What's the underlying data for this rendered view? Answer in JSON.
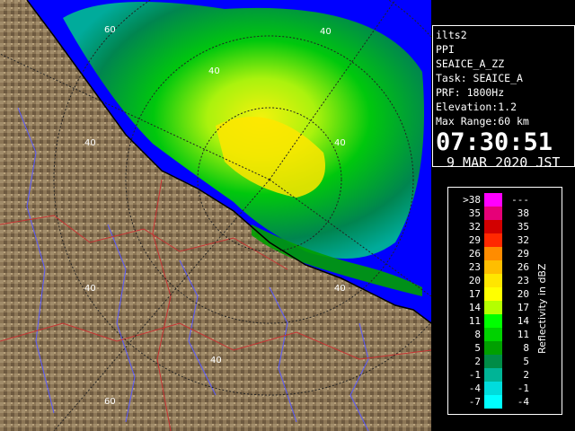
{
  "map": {
    "range_labels": [
      "60",
      "40",
      "40",
      "40",
      "40",
      "40",
      "40",
      "60"
    ],
    "colors": {
      "land_light": "#a28d6b",
      "land_dark": "#6e5a40",
      "sea": "#0000ff",
      "river": "#5a5aff",
      "border": "#c83232",
      "ring": "#222222"
    }
  },
  "info": {
    "site": "ilts2",
    "mode": "PPI",
    "product": "SEAICE_A_ZZ",
    "task": "Task: SEAICE_A",
    "prf": "PRF: 1800Hz",
    "elevation": "Elevation:1.2",
    "max_range": "Max Range:60 km",
    "time": "07:30:51",
    "date": "9 MAR 2020 JST"
  },
  "legend": {
    "unit": "Reflectivity in dBZ",
    "rows": [
      {
        "lo": ">38",
        "hi": "---",
        "color": "#ff00ff"
      },
      {
        "lo": "35",
        "hi": "38",
        "color": "#e60078"
      },
      {
        "lo": "32",
        "hi": "35",
        "color": "#d20000"
      },
      {
        "lo": "29",
        "hi": "32",
        "color": "#ff2800"
      },
      {
        "lo": "26",
        "hi": "29",
        "color": "#ff8c00"
      },
      {
        "lo": "23",
        "hi": "26",
        "color": "#ffbe00"
      },
      {
        "lo": "20",
        "hi": "23",
        "color": "#ffe600"
      },
      {
        "lo": "17",
        "hi": "20",
        "color": "#ffff00"
      },
      {
        "lo": "14",
        "hi": "17",
        "color": "#b4ff00"
      },
      {
        "lo": "11",
        "hi": "14",
        "color": "#00ff00"
      },
      {
        "lo": "8",
        "hi": "11",
        "color": "#00d200"
      },
      {
        "lo": "5",
        "hi": "8",
        "color": "#00a000"
      },
      {
        "lo": "2",
        "hi": "5",
        "color": "#008c46"
      },
      {
        "lo": "-1",
        "hi": "2",
        "color": "#00b496"
      },
      {
        "lo": "-4",
        "hi": "-1",
        "color": "#00dcdc"
      },
      {
        "lo": "-7",
        "hi": "-4",
        "color": "#00ffff"
      }
    ]
  }
}
